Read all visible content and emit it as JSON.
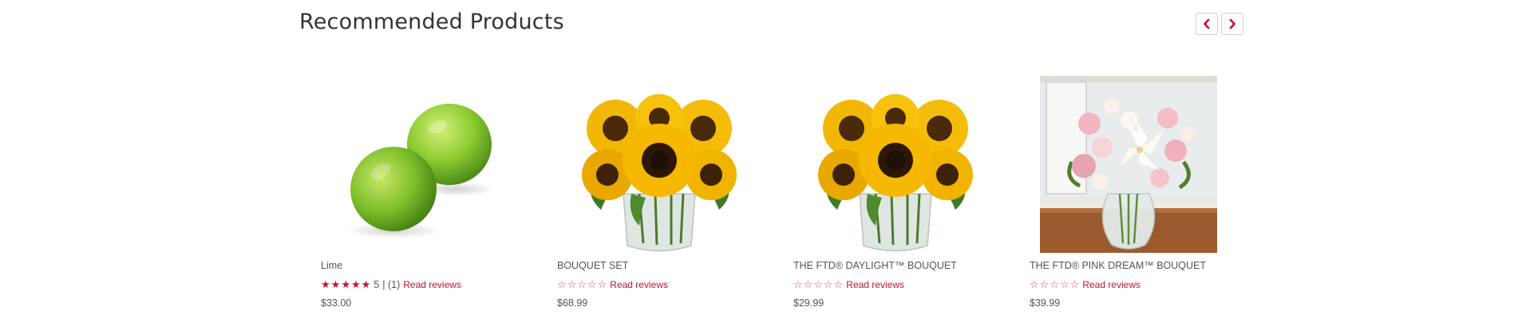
{
  "section": {
    "title": "Recommended Products",
    "prev_icon": "chevron-left-icon",
    "next_icon": "chevron-right-icon",
    "accent_color": "#c8102e"
  },
  "products": [
    {
      "name": "Lime",
      "rating": "5",
      "rating_count": "| (1)",
      "rating_value": 5,
      "reviews_label": "Read reviews",
      "price": "$33.00",
      "image": "limes"
    },
    {
      "name": "BOUQUET SET",
      "rating_value": 0,
      "reviews_label": "Read reviews",
      "price": "$68.99",
      "image": "sunflowers"
    },
    {
      "name": "THE FTD® DAYLIGHT™ BOUQUET",
      "rating_value": 0,
      "reviews_label": "Read reviews",
      "price": "$29.99",
      "image": "sunflowers"
    },
    {
      "name": "THE FTD® PINK DREAM™ BOUQUET",
      "rating_value": 0,
      "reviews_label": "Read reviews",
      "price": "$39.99",
      "image": "pink-lilies-roses"
    }
  ]
}
